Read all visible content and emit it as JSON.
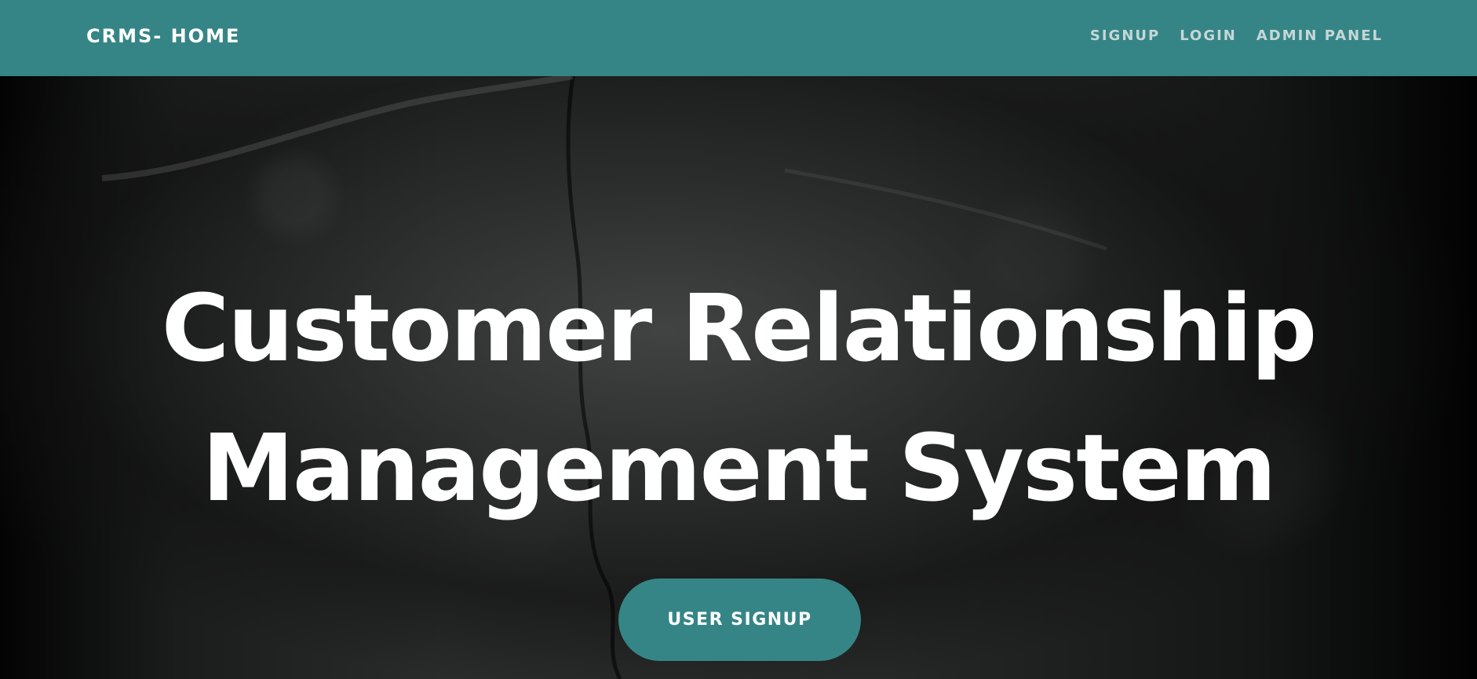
{
  "navbar": {
    "brand": "CRMS- HOME",
    "links": [
      {
        "label": "SIGNUP"
      },
      {
        "label": "LOGIN"
      },
      {
        "label": "ADMIN PANEL"
      }
    ]
  },
  "hero": {
    "title_line_1": "Customer Relationship",
    "title_line_2": "Management System",
    "button_label": "USER SIGNUP"
  },
  "colors": {
    "navbar_background": "#368586",
    "button_background": "#368586",
    "nav_link_text": "#c6d7d7",
    "hero_text": "#ffffff",
    "hero_background": "#111111"
  },
  "icons": []
}
